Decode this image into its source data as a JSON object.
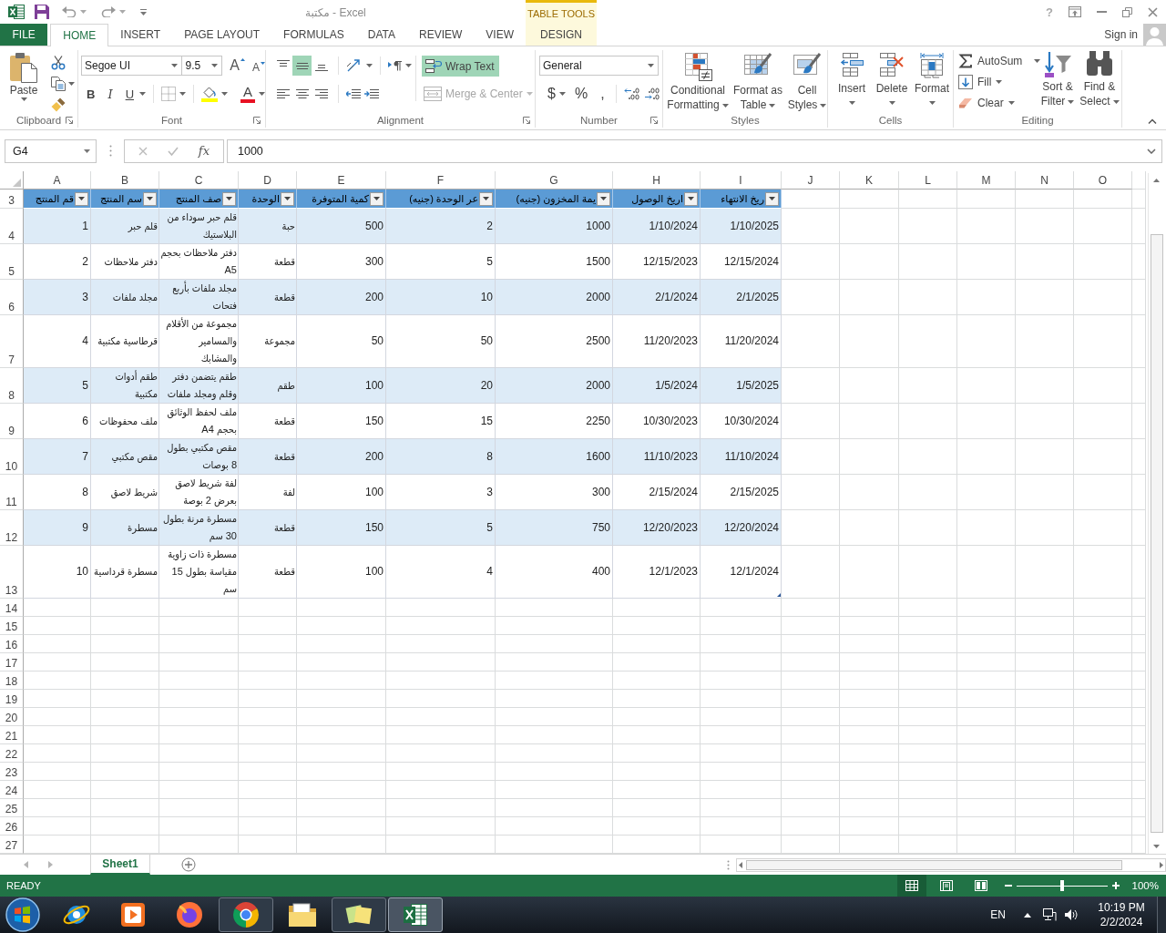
{
  "title_bar": {
    "title": "مكتبة - Excel",
    "contextual_group": "TABLE TOOLS",
    "help": "?"
  },
  "tabs": [
    {
      "label": "DESIGN",
      "kind": "contextual",
      "selected": false
    },
    {
      "label": "VIEW",
      "kind": "standard",
      "selected": false
    },
    {
      "label": "REVIEW",
      "kind": "standard",
      "selected": false
    },
    {
      "label": "DATA",
      "kind": "standard",
      "selected": false
    },
    {
      "label": "FORMULAS",
      "kind": "standard",
      "selected": false
    },
    {
      "label": "PAGE LAYOUT",
      "kind": "standard",
      "selected": false
    },
    {
      "label": "INSERT",
      "kind": "standard",
      "selected": false
    },
    {
      "label": "HOME",
      "kind": "standard",
      "selected": true
    },
    {
      "label": "FILE",
      "kind": "file",
      "selected": false
    }
  ],
  "account": {
    "label": "Sign in"
  },
  "ribbon": {
    "clipboard": {
      "label": "Clipboard",
      "paste": "Paste"
    },
    "font": {
      "label": "Font",
      "font_name": "Segoe UI",
      "font_size": "9.5",
      "grow": "A",
      "shrink": "A",
      "styles": [
        {
          "kind": "underline",
          "label": "U"
        },
        {
          "kind": "italic",
          "label": "I"
        },
        {
          "kind": "bold",
          "label": "B"
        }
      ],
      "font_color": "A"
    },
    "alignment": {
      "label": "Alignment",
      "vertical": [
        {
          "kind": "bottom",
          "selected": false
        },
        {
          "kind": "middle",
          "selected": true
        },
        {
          "kind": "top",
          "selected": false
        }
      ],
      "wrap_text": {
        "label": "Wrap Text",
        "selected": true
      },
      "merge_center": {
        "label": "Merge & Center",
        "disabled": true
      }
    },
    "number": {
      "label": "Number",
      "format": "General",
      "currency": "$",
      "percent": "%",
      "comma": ","
    },
    "styles": {
      "label": "Styles",
      "buttons": [
        {
          "kind": "cell_styles",
          "label": "Cell\nStyles"
        },
        {
          "kind": "table",
          "label": "Format as\nTable"
        },
        {
          "kind": "conditional",
          "label": "Conditional\nFormatting"
        }
      ]
    },
    "cells": {
      "label": "Cells",
      "buttons": [
        {
          "kind": "format",
          "label": "Format"
        },
        {
          "kind": "delete",
          "label": "Delete"
        },
        {
          "kind": "insert",
          "label": "Insert"
        }
      ]
    },
    "editing": {
      "label": "Editing",
      "small": [
        {
          "kind": "autosum",
          "label": "AutoSum"
        },
        {
          "kind": "fill",
          "label": "Fill"
        },
        {
          "kind": "clear",
          "label": "Clear"
        }
      ],
      "large": [
        {
          "kind": "find",
          "label": "Find &\nSelect"
        },
        {
          "kind": "sort",
          "label": "Sort &\nFilter"
        }
      ]
    }
  },
  "formula_bar": {
    "name_box": "G4",
    "function_label": "fx",
    "value": "1000"
  },
  "sheet": {
    "column_letters": [
      "O",
      "N",
      "M",
      "L",
      "K",
      "J",
      "I",
      "H",
      "G",
      "F",
      "E",
      "D",
      "C",
      "B",
      "A"
    ],
    "row_numbers": [
      "3",
      "4",
      "5",
      "6",
      "7",
      "8",
      "9",
      "10",
      "11",
      "12",
      "13",
      "14",
      "15",
      "16",
      "17",
      "18",
      "19",
      "20",
      "21",
      "22",
      "23",
      "24",
      "25",
      "26",
      "27"
    ],
    "table": {
      "columns": [
        {
          "label": "ريخ الانتهاء",
          "kind": "number"
        },
        {
          "label": "اريخ الوصول",
          "kind": "number"
        },
        {
          "label": "يمة المخزون (جنيه)",
          "kind": "number"
        },
        {
          "label": "عر الوحدة (جنيه)",
          "kind": "number"
        },
        {
          "label": "كمية المتوفرة",
          "kind": "number"
        },
        {
          "label": "الوحدة",
          "kind": "text"
        },
        {
          "label": "صف المنتج",
          "kind": "text"
        },
        {
          "label": "سم المنتج",
          "kind": "text"
        },
        {
          "label": "قم المنتج",
          "kind": "number"
        }
      ],
      "rows": [
        [
          "1/10/2025",
          "1/10/2024",
          "1000",
          "2",
          "500",
          "حبة",
          "قلم حبر سوداء من البلاستيك",
          "قلم حبر",
          "1"
        ],
        [
          "12/15/2024",
          "12/15/2023",
          "1500",
          "5",
          "300",
          "قطعة",
          "دفتر ملاحظات بحجم A5",
          "دفتر ملاحظات",
          "2"
        ],
        [
          "2/1/2025",
          "2/1/2024",
          "2000",
          "10",
          "200",
          "قطعة",
          "مجلد ملفات بأربع فتحات",
          "مجلد ملفات",
          "3"
        ],
        [
          "11/20/2024",
          "11/20/2023",
          "2500",
          "50",
          "50",
          "مجموعة",
          "مجموعة من الأقلام والمسامير والمشابك",
          "قرطاسية مكتبية",
          "4"
        ],
        [
          "1/5/2025",
          "1/5/2024",
          "2000",
          "20",
          "100",
          "طقم",
          "طقم يتضمن دفتر وقلم ومجلد ملفات",
          "طقم أدوات مكتبية",
          "5"
        ],
        [
          "10/30/2024",
          "10/30/2023",
          "2250",
          "15",
          "150",
          "قطعة",
          "ملف لحفظ الوثائق بحجم A4",
          "ملف محفوظات",
          "6"
        ],
        [
          "11/10/2024",
          "11/10/2023",
          "1600",
          "8",
          "200",
          "قطعة",
          "مقص مكتبي بطول 8 بوصات",
          "مقص مكتبي",
          "7"
        ],
        [
          "2/15/2025",
          "2/15/2024",
          "300",
          "3",
          "100",
          "لفة",
          "لفة شريط لاصق بعرض 2 بوصة",
          "شريط لاصق",
          "8"
        ],
        [
          "12/20/2024",
          "12/20/2023",
          "750",
          "5",
          "150",
          "قطعة",
          "مسطرة مرنة بطول 30 سم",
          "مسطرة",
          "9"
        ],
        [
          "12/1/2024",
          "12/1/2023",
          "400",
          "4",
          "100",
          "قطعة",
          "مسطرة ذات زاوية مقياسة بطول 15 سم",
          "مسطرة قرداسية",
          "10"
        ]
      ]
    }
  },
  "sheet_tabs": [
    {
      "label": "Sheet1",
      "selected": true
    }
  ],
  "status_bar": {
    "mode": "READY",
    "views": [
      {
        "kind": "page_break",
        "selected": false
      },
      {
        "kind": "page_layout",
        "selected": false
      },
      {
        "kind": "normal",
        "selected": true
      }
    ],
    "zoom": {
      "level": 0.5,
      "reading": "100%"
    }
  },
  "taskbar": {
    "apps": [
      {
        "kind": "excel",
        "running": true,
        "selected": true
      },
      {
        "kind": "sticky",
        "running": true,
        "selected": false
      },
      {
        "kind": "explorer",
        "running": false,
        "selected": false
      },
      {
        "kind": "chrome",
        "running": true,
        "selected": false
      },
      {
        "kind": "firefox",
        "running": false,
        "selected": false
      },
      {
        "kind": "media",
        "running": false,
        "selected": false
      },
      {
        "kind": "ie",
        "running": false,
        "selected": false
      }
    ],
    "language": "EN",
    "time": "10:19 PM",
    "date": "2/2/2024"
  }
}
